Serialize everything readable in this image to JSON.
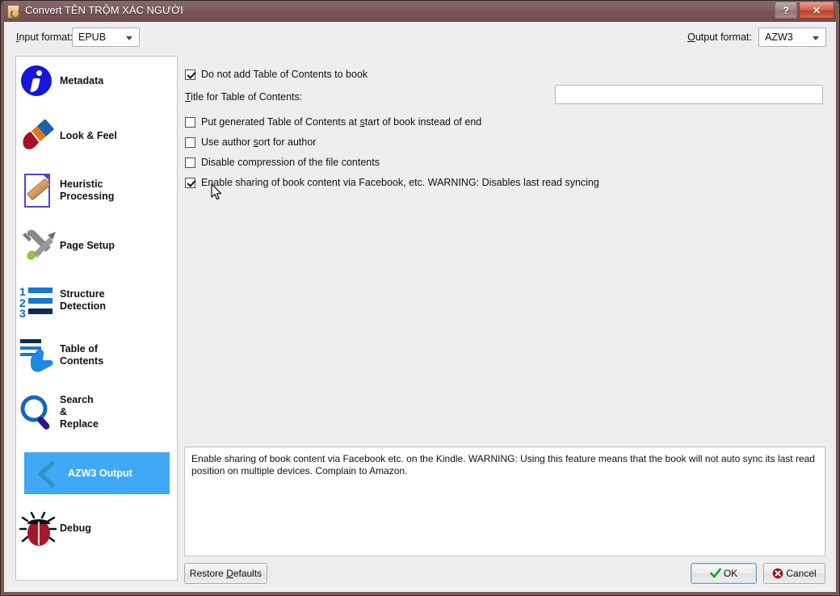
{
  "window": {
    "title": "Convert TÊN TRỘM XÁC NGƯỜI",
    "icon": "book-icon",
    "help_label": "?",
    "close_label": "✕",
    "accent_titlebar": "#7a5a5a",
    "accent_selected": "#3fa9f5"
  },
  "format_bar": {
    "input_label_prefix": "I",
    "input_label_rest": "nput format:",
    "input_value": "EPUB",
    "output_label_prefix": "O",
    "output_label_rest": "utput format:",
    "output_value": "AZW3"
  },
  "sidebar": {
    "items": [
      {
        "label": "Metadata",
        "icon": "info-icon",
        "selected": false
      },
      {
        "label": "Look & Feel",
        "icon": "paintbrush-icon",
        "selected": false
      },
      {
        "label": "Heuristic\nProcessing",
        "icon": "document-bandage-icon",
        "selected": false
      },
      {
        "label": "Page Setup",
        "icon": "wrench-screwdriver-icon",
        "selected": false
      },
      {
        "label": "Structure\nDetection",
        "icon": "numbered-list-icon",
        "selected": false
      },
      {
        "label": "Table of\nContents",
        "icon": "toc-hand-icon",
        "selected": false
      },
      {
        "label": "Search\n&\nReplace",
        "icon": "magnifier-icon",
        "selected": false
      },
      {
        "label": "AZW3 Output",
        "icon": "chevron-left-icon",
        "selected": true
      },
      {
        "label": "Debug",
        "icon": "ladybug-icon",
        "selected": false
      }
    ]
  },
  "options": {
    "checkboxes": [
      {
        "label": "Do not add Table of Contents to book",
        "checked": true
      },
      {
        "label": "Put generated Table of Contents at start of book instead of end",
        "checked": false,
        "accel_before": "Put generated Table of Contents at ",
        "accel": "s",
        "accel_after": "tart of book instead of end"
      },
      {
        "label": "Use author sort for author",
        "checked": false,
        "accel_before": "Use author ",
        "accel": "s",
        "accel_after": "ort for author"
      },
      {
        "label": "Disable compression of the file contents",
        "checked": false
      },
      {
        "label": "Enable sharing of book content via Facebook, etc. WARNING: Disables last read syncing",
        "checked": true
      }
    ],
    "toc_title_accel": "T",
    "toc_title_label_rest": "itle for Table of Contents:",
    "toc_title_value": "",
    "toc_title_placeholder": ""
  },
  "description": {
    "text": "Enable sharing of book content via Facebook etc.  on the Kindle. WARNING: Using this feature means that  the book will not auto sync its last read position  on multiple devices. Complain to Amazon."
  },
  "footer": {
    "restore_before": "Restore ",
    "restore_accel": "D",
    "restore_after": "efaults",
    "ok_label": "OK",
    "cancel_label": "Cancel"
  }
}
